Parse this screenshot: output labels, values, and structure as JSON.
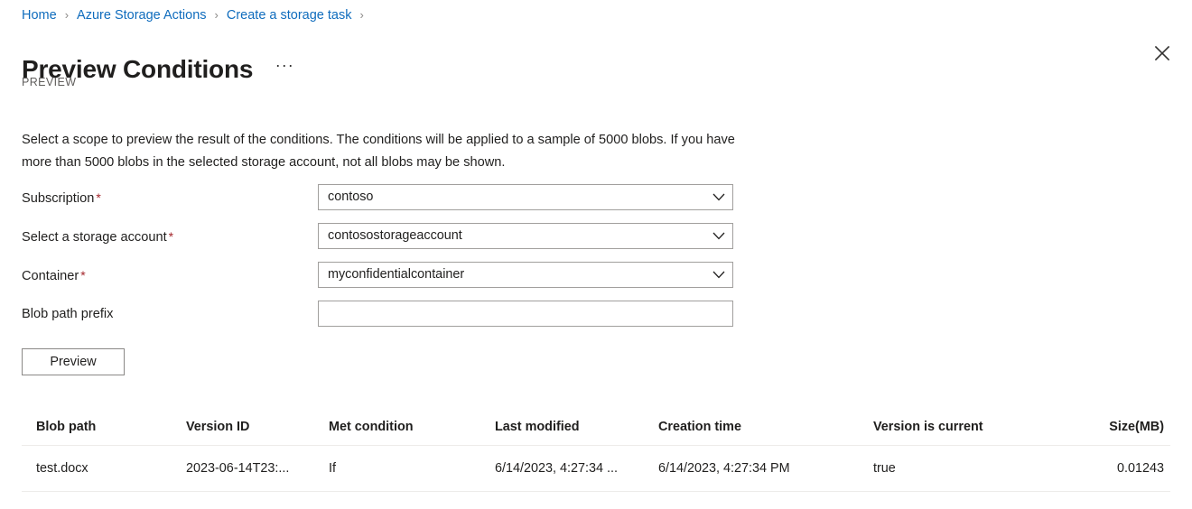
{
  "breadcrumb": {
    "items": [
      {
        "label": "Home"
      },
      {
        "label": "Azure Storage Actions"
      },
      {
        "label": "Create a storage task"
      }
    ],
    "separator": "›"
  },
  "header": {
    "title": "Preview Conditions",
    "ellipsis": "···",
    "preview_tag": "PREVIEW",
    "close_icon": "close-icon"
  },
  "description": "Select a scope to preview the result of the conditions. The conditions will be applied to a sample of 5000 blobs. If you have more than 5000 blobs in the selected storage account, not all blobs may be shown.",
  "form": {
    "required_marker": "*",
    "fields": [
      {
        "label": "Subscription",
        "required": true,
        "type": "dropdown",
        "value": "contoso",
        "placeholder": ""
      },
      {
        "label": "Select a storage account",
        "required": true,
        "type": "dropdown",
        "value": "contosostorageaccount",
        "placeholder": ""
      },
      {
        "label": "Container",
        "required": true,
        "type": "dropdown",
        "value": "myconfidentialcontainer",
        "placeholder": ""
      },
      {
        "label": "Blob path prefix",
        "required": false,
        "type": "text",
        "value": "",
        "placeholder": ""
      }
    ],
    "preview_button": "Preview"
  },
  "table": {
    "columns": [
      "Blob path",
      "Version ID",
      "Met condition",
      "Last modified",
      "Creation time",
      "Version is current",
      "Size(MB)"
    ],
    "rows": [
      {
        "blob_path": "test.docx",
        "version_id": "2023-06-14T23:...",
        "met_condition": "If",
        "last_modified": "6/14/2023, 4:27:34 ...",
        "creation_time": "6/14/2023, 4:27:34 PM",
        "version_is_current": "true",
        "size_mb": "0.01243"
      }
    ]
  },
  "colors": {
    "link": "#0f6cbd",
    "required": "#a4262c",
    "text": "#201f1e",
    "muted": "#605e5c",
    "border": "#a19f9d",
    "divider": "#edebe9"
  }
}
